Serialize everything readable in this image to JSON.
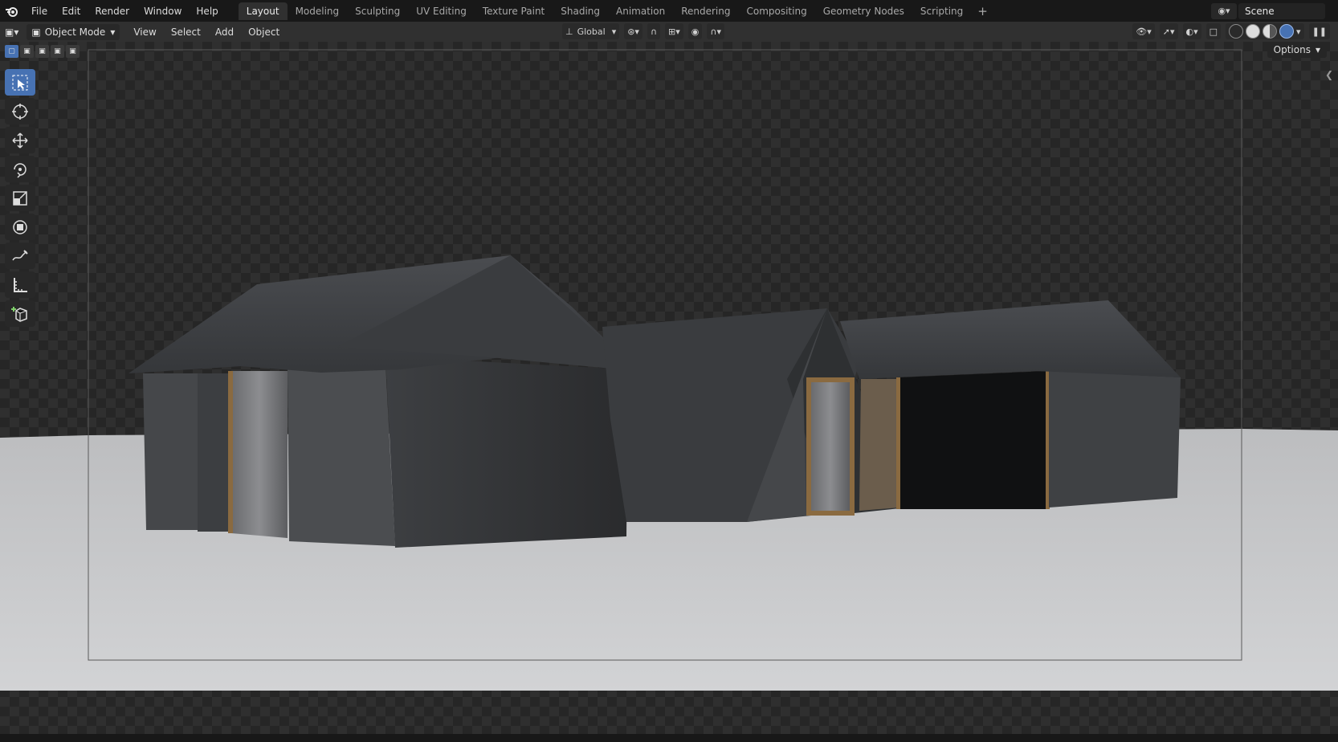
{
  "topbar": {
    "menus": [
      "File",
      "Edit",
      "Render",
      "Window",
      "Help"
    ],
    "workspaces": [
      "Layout",
      "Modeling",
      "Sculpting",
      "UV Editing",
      "Texture Paint",
      "Shading",
      "Animation",
      "Rendering",
      "Compositing",
      "Geometry Nodes",
      "Scripting"
    ],
    "active_workspace": "Layout",
    "add_tab": "+",
    "scene_name": "Scene"
  },
  "header": {
    "mode": "Object Mode",
    "menus": [
      "View",
      "Select",
      "Add",
      "Object"
    ],
    "transform_orientation": "Global",
    "options_label": "Options"
  },
  "toolbar": {
    "tools": [
      "select-box",
      "cursor",
      "move",
      "rotate",
      "scale",
      "transform",
      "annotate",
      "measure",
      "add-cube"
    ],
    "active_tool": "select-box"
  },
  "colors": {
    "accent": "#4772b3",
    "topbar_bg": "#181818",
    "header_bg": "#303030",
    "floor": "#c9cacc",
    "tent_fabric": "#2c2d2f"
  }
}
